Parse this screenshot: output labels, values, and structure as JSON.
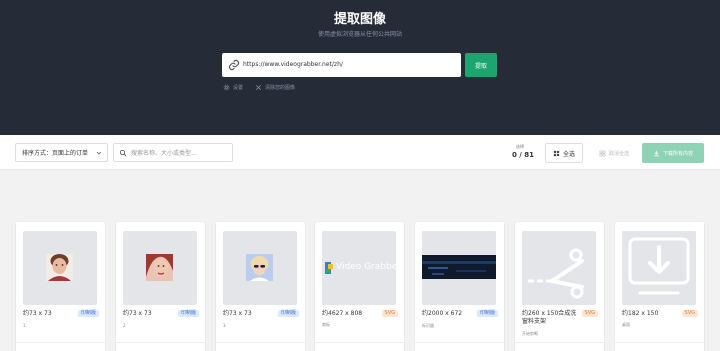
{
  "header": {
    "title": "提取图像",
    "subtitle": "使用虚拟浏览器从任何公共网站",
    "url_value": "https://www.videograbber.net/zh/",
    "extract_label": "提取",
    "settings_label": "设置",
    "clear_label": "清除您的图像"
  },
  "toolbar": {
    "sort_label": "排序方式：页面上的订单",
    "search_placeholder": "搜索名称、大小或类型...",
    "selected_label": "选择",
    "selected_count": "0 / 81",
    "select_all_label": "全选",
    "deselect_all_label": "取消全选",
    "download_all_label": "下载所有内容"
  },
  "cards": [
    {
      "dims": "约73 x 73",
      "badge": "印制版",
      "caption": "1",
      "thumb": "face-man-icon"
    },
    {
      "dims": "约73 x 73",
      "badge": "印制版",
      "caption": "2",
      "thumb": "face-woman-icon"
    },
    {
      "dims": "约73 x 73",
      "badge": "印制版",
      "caption": "3",
      "thumb": "face-sunglasses-icon"
    },
    {
      "dims": "约4627 x 808",
      "badge": "SVG",
      "caption": "商标",
      "thumb": "video-grabber-logo",
      "logo_text": "Video Grabber"
    },
    {
      "dims": "约2000 x 672",
      "badge": "印制版",
      "caption": "标识器",
      "thumb": "dark-banner"
    },
    {
      "dims": "约260 x 150合成洗\n窗料支架",
      "badge": "SVG",
      "caption": "开始剪断",
      "thumb": "scissors-icon"
    },
    {
      "dims": "约182 x 150",
      "badge": "SVG",
      "caption": "桌面",
      "thumb": "download-monitor-icon"
    }
  ],
  "colors": {
    "header_bg": "#262b38",
    "accent": "#1ca56f",
    "download_all_bg": "#8fd3b6",
    "badge_blue": "#3a6fd8",
    "badge_orange": "#e07a2a"
  }
}
